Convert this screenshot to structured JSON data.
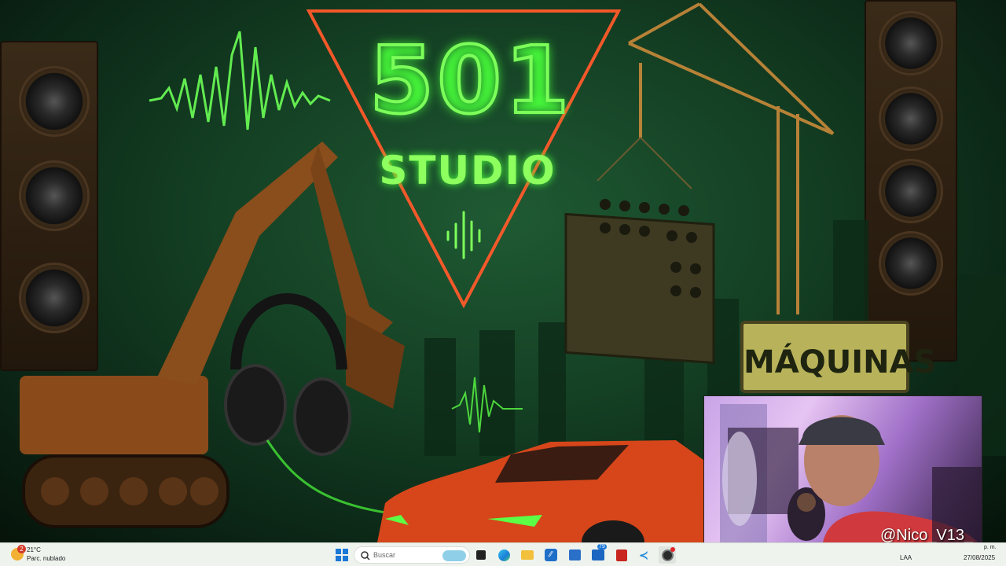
{
  "wallpaper": {
    "logo_number": "501",
    "logo_word": "STUDIO",
    "sign_text": "MÁQUINAS",
    "colors": {
      "accent": "#7dff5a",
      "triangle": "#ff5a2a",
      "background": "#133d22"
    }
  },
  "webcam": {
    "handle": "@Nico_V13_"
  },
  "taskbar": {
    "weather": {
      "temperature": "21°C",
      "condition": "Parc. nublado",
      "alert_count": "2"
    },
    "search_placeholder": "Buscar",
    "apps": [
      {
        "name": "windows-start",
        "icon": "windows-logo-icon"
      },
      {
        "name": "search",
        "icon": "search-icon"
      },
      {
        "name": "widgets",
        "icon": "widgets-icon"
      },
      {
        "name": "task-view",
        "icon": "task-view-icon"
      },
      {
        "name": "edge",
        "icon": "edge-icon"
      },
      {
        "name": "file-explorer",
        "icon": "folder-icon"
      },
      {
        "name": "azure-data",
        "icon": "app-icon"
      },
      {
        "name": "store",
        "icon": "store-icon"
      },
      {
        "name": "outlook",
        "icon": "mail-icon",
        "badge": "79"
      },
      {
        "name": "acrobat",
        "icon": "pdf-icon"
      },
      {
        "name": "vscode",
        "icon": "vscode-icon"
      },
      {
        "name": "obs",
        "icon": "obs-icon"
      }
    ],
    "tray": {
      "language": "LAA",
      "time": "p. m.",
      "date": "27/08/2025"
    }
  }
}
